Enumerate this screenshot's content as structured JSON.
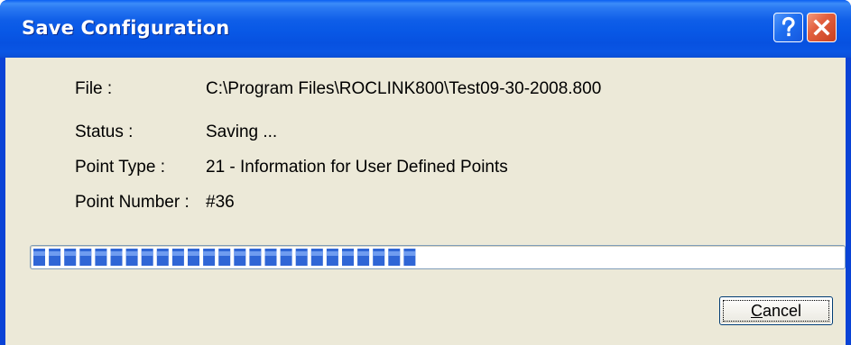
{
  "window": {
    "title": "Save Configuration",
    "help_icon": "question-mark-icon",
    "close_icon": "close-x-icon"
  },
  "fields": [
    {
      "label": "File :",
      "value": "C:\\Program Files\\ROCLINK800\\Test09-30-2008.800"
    },
    {
      "label": "Status :",
      "value": "Saving ..."
    },
    {
      "label": "Point Type :",
      "value": "21 - Information for User Defined Points"
    },
    {
      "label": "Point Number :",
      "value": "#36"
    }
  ],
  "progress": {
    "fraction": 0.48,
    "color": "#2f66d6"
  },
  "buttons": {
    "cancel_accel": "C",
    "cancel_rest": "ancel"
  },
  "colors": {
    "titlebar": "#0858e6",
    "dialog_bg": "#ece9d8",
    "close_button": "#e2603f"
  }
}
